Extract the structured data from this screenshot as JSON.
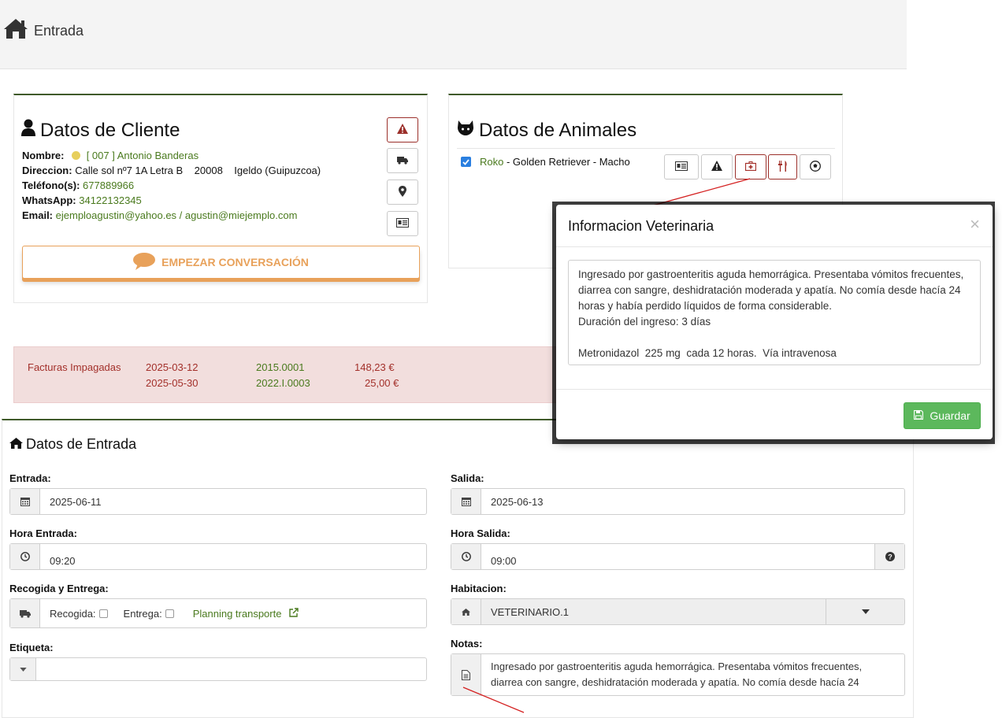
{
  "header": {
    "title": "Entrada"
  },
  "cliente": {
    "title": "Datos de Cliente",
    "nombre_label": "Nombre:",
    "nombre_value": "[ 007 ] Antonio Banderas",
    "direccion_label": "Direccion:",
    "direccion_value": "Calle sol nº7 1A Letra B",
    "cp": "20008",
    "ciudad": "Igeldo (Guipuzcoa)",
    "telefono_label": "Teléfono(s):",
    "telefono_value": "677889966",
    "whatsapp_label": "WhatsApp:",
    "whatsapp_value": "34122132345",
    "email_label": "Email:",
    "email_value": "ejemploagustin@yahoo.es / agustin@miejemplo.com",
    "cta_label": "EMPEZAR CONVERSACIÓN"
  },
  "animales": {
    "title": "Datos de Animales",
    "animal_name": "Roko",
    "animal_desc": " - Golden Retriever - Macho",
    "checked": true
  },
  "facturas": {
    "label": "Facturas Impagadas",
    "rows": [
      {
        "fecha": "2025-03-12",
        "numero": "2015.0001",
        "importe": "148,23 €"
      },
      {
        "fecha": "2025-05-30",
        "numero": "2022.I.0003",
        "importe": "25,00 €"
      }
    ]
  },
  "entrada": {
    "title": "Datos de Entrada",
    "entrada_label": "Entrada:",
    "entrada_value": "2025-06-11",
    "salida_label": "Salida:",
    "salida_value": "2025-06-13",
    "hora_entrada_label": "Hora Entrada:",
    "hora_entrada_value": "09:20",
    "hora_salida_label": "Hora Salida:",
    "hora_salida_value": "09:00",
    "recogida_label": "Recogida y Entrega:",
    "recogida_text": "Recogida:",
    "entrega_text": "Entrega:",
    "planning_link": "Planning transporte",
    "habitacion_label": "Habitacion:",
    "habitacion_value": "VETERINARIO.1",
    "etiqueta_label": "Etiqueta:",
    "notas_label": "Notas:",
    "notas_value": "Ingresado por gastroenteritis aguda hemorrágica. Presentaba vómitos frecuentes, diarrea con sangre, deshidratación moderada y apatía. No comía desde hacía 24"
  },
  "modal": {
    "title": "Informacion Veterinaria",
    "close": "×",
    "text": "Ingresado por gastroenteritis aguda hemorrágica. Presentaba vómitos frecuentes, diarrea con sangre, deshidratación moderada y apatía. No comía desde hacía 24 horas y había perdido líquidos de forma considerable.\nDuración del ingreso: 3 días\n\nMetronidazol  225 mg  cada 12 horas.  Vía intravenosa",
    "save_label": "Guardar"
  },
  "colors": {
    "accent_green": "#4a7a1e",
    "danger": "#a3302a",
    "cta": "#e8a15a",
    "save": "#5cb85c"
  }
}
